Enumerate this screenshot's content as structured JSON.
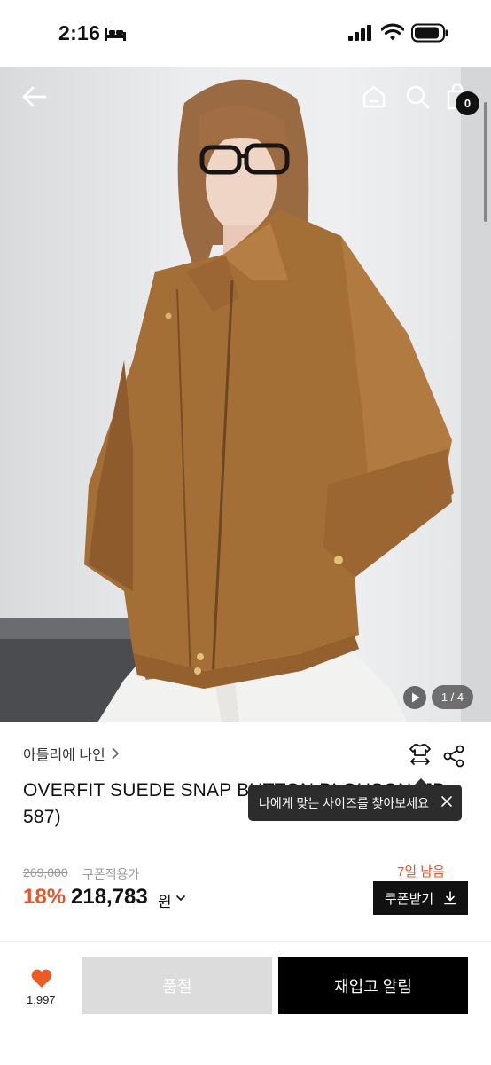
{
  "status_bar": {
    "time": "2:16",
    "icons": [
      "bed-icon",
      "signal-icon",
      "wifi-icon",
      "battery-icon"
    ]
  },
  "hero": {
    "cart_count": "0",
    "page_indicator": "1 / 4",
    "icons": [
      "back-arrow-icon",
      "home-icon",
      "search-icon",
      "shopping-bag-icon",
      "play-icon"
    ]
  },
  "product": {
    "brand": "아틀리에 나인",
    "title": "OVERFIT SUEDE SNAP BUTTON BLOUSON (JB-587)",
    "size_tooltip": "나에게 맞는 사이즈를 찾아보세요",
    "original_price": "269,000",
    "coupon_note": "쿠폰적용가",
    "days_left": "7일 남음",
    "discount": "18%",
    "price": "218,783",
    "price_unit": "원",
    "coupon_button": "쿠폰받기"
  },
  "bottom_bar": {
    "like_count": "1,997",
    "soldout_label": "품절",
    "restock_label": "재입고 알림"
  },
  "colors": {
    "accent": "#e8542a",
    "dark": "#111111",
    "soldout_bg": "#dcdcdc"
  }
}
